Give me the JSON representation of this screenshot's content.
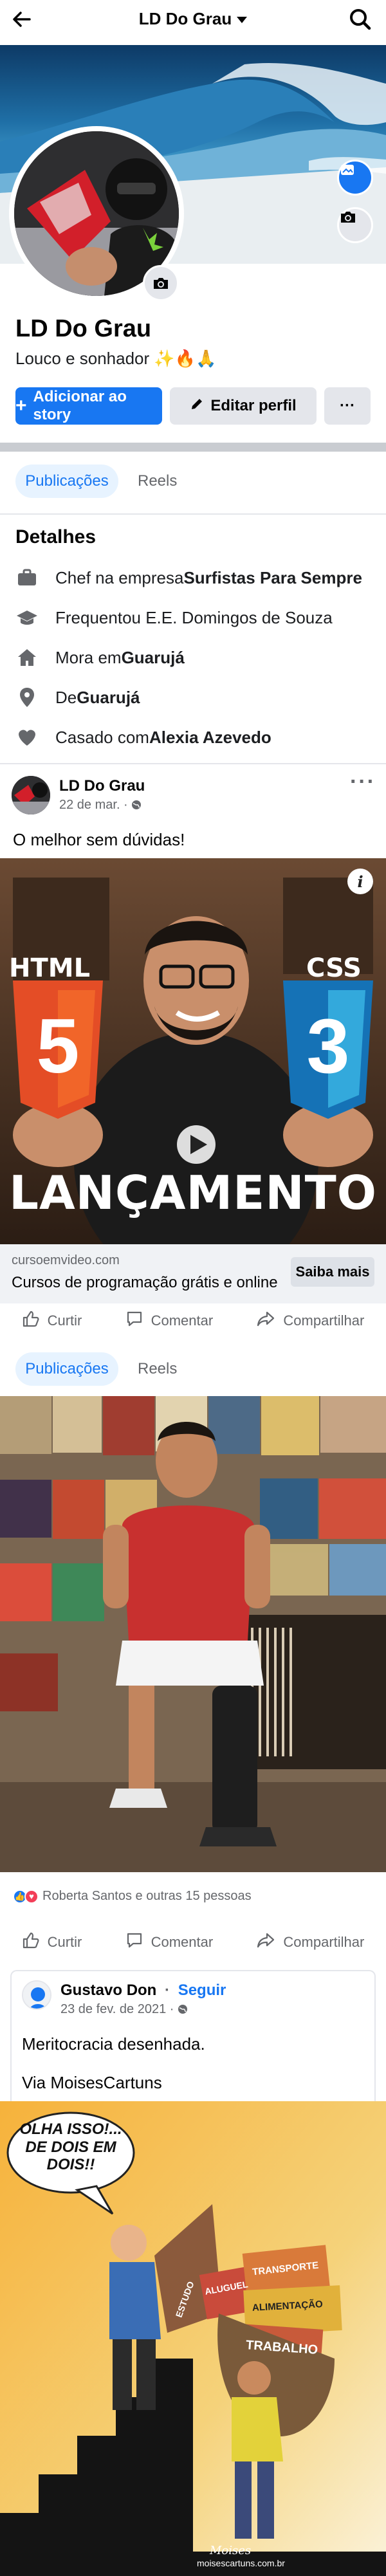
{
  "header": {
    "title": "LD Do Grau"
  },
  "profile": {
    "name": "LD Do Grau",
    "bio": "Louco e sonhador ✨🔥🙏",
    "add_story_label": "Adicionar ao story",
    "edit_profile_label": "Editar perfil",
    "more_label": "···"
  },
  "tabs": {
    "posts": "Publicações",
    "reels": "Reels"
  },
  "details": {
    "title": "Detalhes",
    "rows": [
      {
        "prefix": "Chef na empresa ",
        "bold": "Surfistas Para Sempre",
        "icon": "briefcase-icon"
      },
      {
        "prefix": "Frequentou E.E. Domingos de Souza",
        "bold": "",
        "icon": "graduation-cap-icon"
      },
      {
        "prefix": "Mora em ",
        "bold": "Guarujá",
        "icon": "home-icon"
      },
      {
        "prefix": "De ",
        "bold": "Guarujá",
        "icon": "location-pin-icon"
      },
      {
        "prefix": "Casado com ",
        "bold": "Alexia Azevedo",
        "icon": "heart-icon"
      }
    ]
  },
  "post1": {
    "author": "LD Do Grau",
    "date": "22 de mar. ·",
    "text": "O melhor sem dúvidas!",
    "image": {
      "left_badge": "HTML",
      "right_badge": "CSS",
      "left_number": "5",
      "right_number": "3",
      "banner": "LANÇAMENTO"
    },
    "link": {
      "domain": "cursoemvideo.com",
      "title": "Cursos de programação grátis e online",
      "cta": "Saiba mais"
    },
    "actions": {
      "like": "Curtir",
      "comment": "Comentar",
      "share": "Compartilhar"
    }
  },
  "post2": {
    "reactions_text": "Roberta Santos e outras 15 pessoas",
    "actions": {
      "like": "Curtir",
      "comment": "Comentar",
      "share": "Compartilhar"
    }
  },
  "shared": {
    "author": "Gustavo Don",
    "separator": "·",
    "follow": "Seguir",
    "date": "23 de fev. de 2021 ·",
    "line1": "Meritocracia desenhada.",
    "line2": "Via MoisesCartuns",
    "cartoon": {
      "speech": "OLHA ISSO!... DE DOIS EM DOIS!!",
      "boxes": [
        "TRANSPORTE",
        "ALIMENTAÇÃO",
        "TRABALHO",
        "ALUGUEL",
        "ESTUDO"
      ],
      "signature": "Moises",
      "credit": "moisescartuns.com.br"
    }
  },
  "colors": {
    "brand": "#1877f2",
    "muted": "#65676b",
    "divider": "#c9ccd1"
  }
}
